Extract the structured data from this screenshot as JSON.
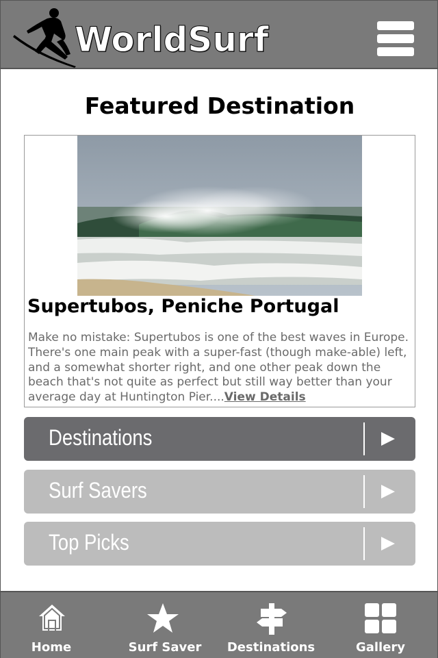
{
  "header": {
    "logo_text": "WorldSurf",
    "logo_icon": "surfer-icon",
    "menu_icon": "hamburger-menu-icon"
  },
  "featured": {
    "section_title": "Featured Destination",
    "image": "wave-photo",
    "title": "Supertubos, Peniche Portugal",
    "description": "Make no mistake: Supertubos is one of the best waves in Europe. There's one main peak with a super-fast (though make-able) left, and a somewhat shorter right, and one other peak down the beach that's not quite as perfect but still way better than your average day at Huntington Pier....",
    "link_label": "View Details"
  },
  "menu": {
    "items": [
      {
        "label": "Destinations",
        "state": "active"
      },
      {
        "label": "Surf Savers",
        "state": "inactive"
      },
      {
        "label": "Top Picks",
        "state": "inactive"
      }
    ]
  },
  "tabbar": {
    "tabs": [
      {
        "label": "Home",
        "icon": "home-icon"
      },
      {
        "label": "Surf Saver",
        "icon": "star-icon"
      },
      {
        "label": "Destinations",
        "icon": "signpost-icon"
      },
      {
        "label": "Gallery",
        "icon": "grid-icon"
      }
    ]
  },
  "colors": {
    "header_bg": "#7a7a7a",
    "active_item": "#6b6b6e",
    "inactive_item": "#bcbcbc"
  }
}
